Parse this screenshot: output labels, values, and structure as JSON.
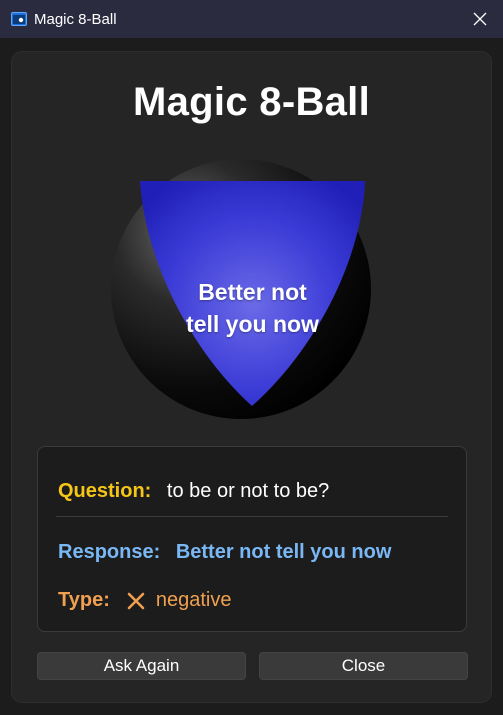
{
  "window": {
    "title": "Magic 8-Ball"
  },
  "main": {
    "heading": "Magic 8-Ball",
    "ball_answer_line1": "Better not",
    "ball_answer_line2": "tell you now"
  },
  "info": {
    "question_label": "Question:",
    "question_value": "to be or not to be?",
    "response_label": "Response:",
    "response_value": "Better not tell you now",
    "type_label": "Type:",
    "type_icon": "x-mark-icon",
    "type_value": "negative"
  },
  "buttons": {
    "ask_again": "Ask Again",
    "close": "Close"
  },
  "colors": {
    "titlebar": "#2b2b40",
    "question": "#f5c518",
    "response": "#7ab8f5",
    "type": "#f0a050",
    "triangle": "#3030c8"
  }
}
